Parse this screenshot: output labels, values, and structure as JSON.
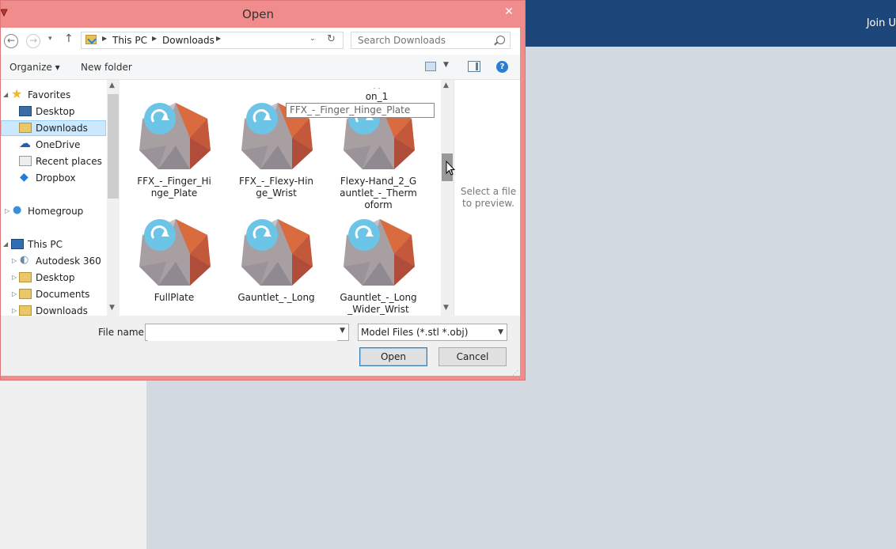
{
  "background": {
    "header_right_text": "Join U"
  },
  "dialog": {
    "title": "Open",
    "close_glyph": "✕",
    "nav": {
      "back_glyph": "←",
      "forward_glyph": "→",
      "recent_glyph": "▾",
      "up_glyph": "↑",
      "breadcrumbs": [
        "This PC",
        "Downloads"
      ],
      "search_placeholder": "Search Downloads"
    },
    "toolbar": {
      "organize": "Organize ▾",
      "new_folder": "New folder",
      "help_glyph": "?"
    },
    "navpane": {
      "items": [
        {
          "label": "Favorites",
          "icon": "star-icon"
        },
        {
          "label": "Desktop",
          "icon": "desktop-icon"
        },
        {
          "label": "Downloads",
          "icon": "downloads-folder-icon",
          "selected": true
        },
        {
          "label": "OneDrive",
          "icon": "onedrive-icon"
        },
        {
          "label": "Recent places",
          "icon": "recent-places-icon"
        },
        {
          "label": "Dropbox",
          "icon": "dropbox-icon"
        },
        {
          "label": "Homegroup",
          "icon": "homegroup-icon"
        },
        {
          "label": "This PC",
          "icon": "this-pc-icon"
        },
        {
          "label": "Autodesk 360",
          "icon": "autodesk-360-icon"
        },
        {
          "label": "Desktop",
          "icon": "desktop-folder-icon"
        },
        {
          "label": "Documents",
          "icon": "documents-folder-icon"
        },
        {
          "label": "Downloads",
          "icon": "downloads-folder-icon"
        }
      ]
    },
    "files": {
      "partial_top_label": "on_1",
      "rename_value": "FFX_-_Finger_Hinge_Plate",
      "tiles": [
        {
          "label": "FFX_-_Finger_Hinge_Plate"
        },
        {
          "label": "FFX_-_Flexy-Hinge_Wrist"
        },
        {
          "label": "Flexy-Hand_2_Gauntlet_-_Thermoform"
        },
        {
          "label": "FullPlate"
        },
        {
          "label": "Gauntlet_-_Long"
        },
        {
          "label": "Gauntlet_-_Long_Wider_Wrist"
        }
      ]
    },
    "preview_text": "Select a file to preview.",
    "file_name_label": "File name:",
    "file_name_value": "",
    "filter_value": "Model Files (*.stl *.obj)",
    "open_button": "Open",
    "cancel_button": "Cancel"
  }
}
